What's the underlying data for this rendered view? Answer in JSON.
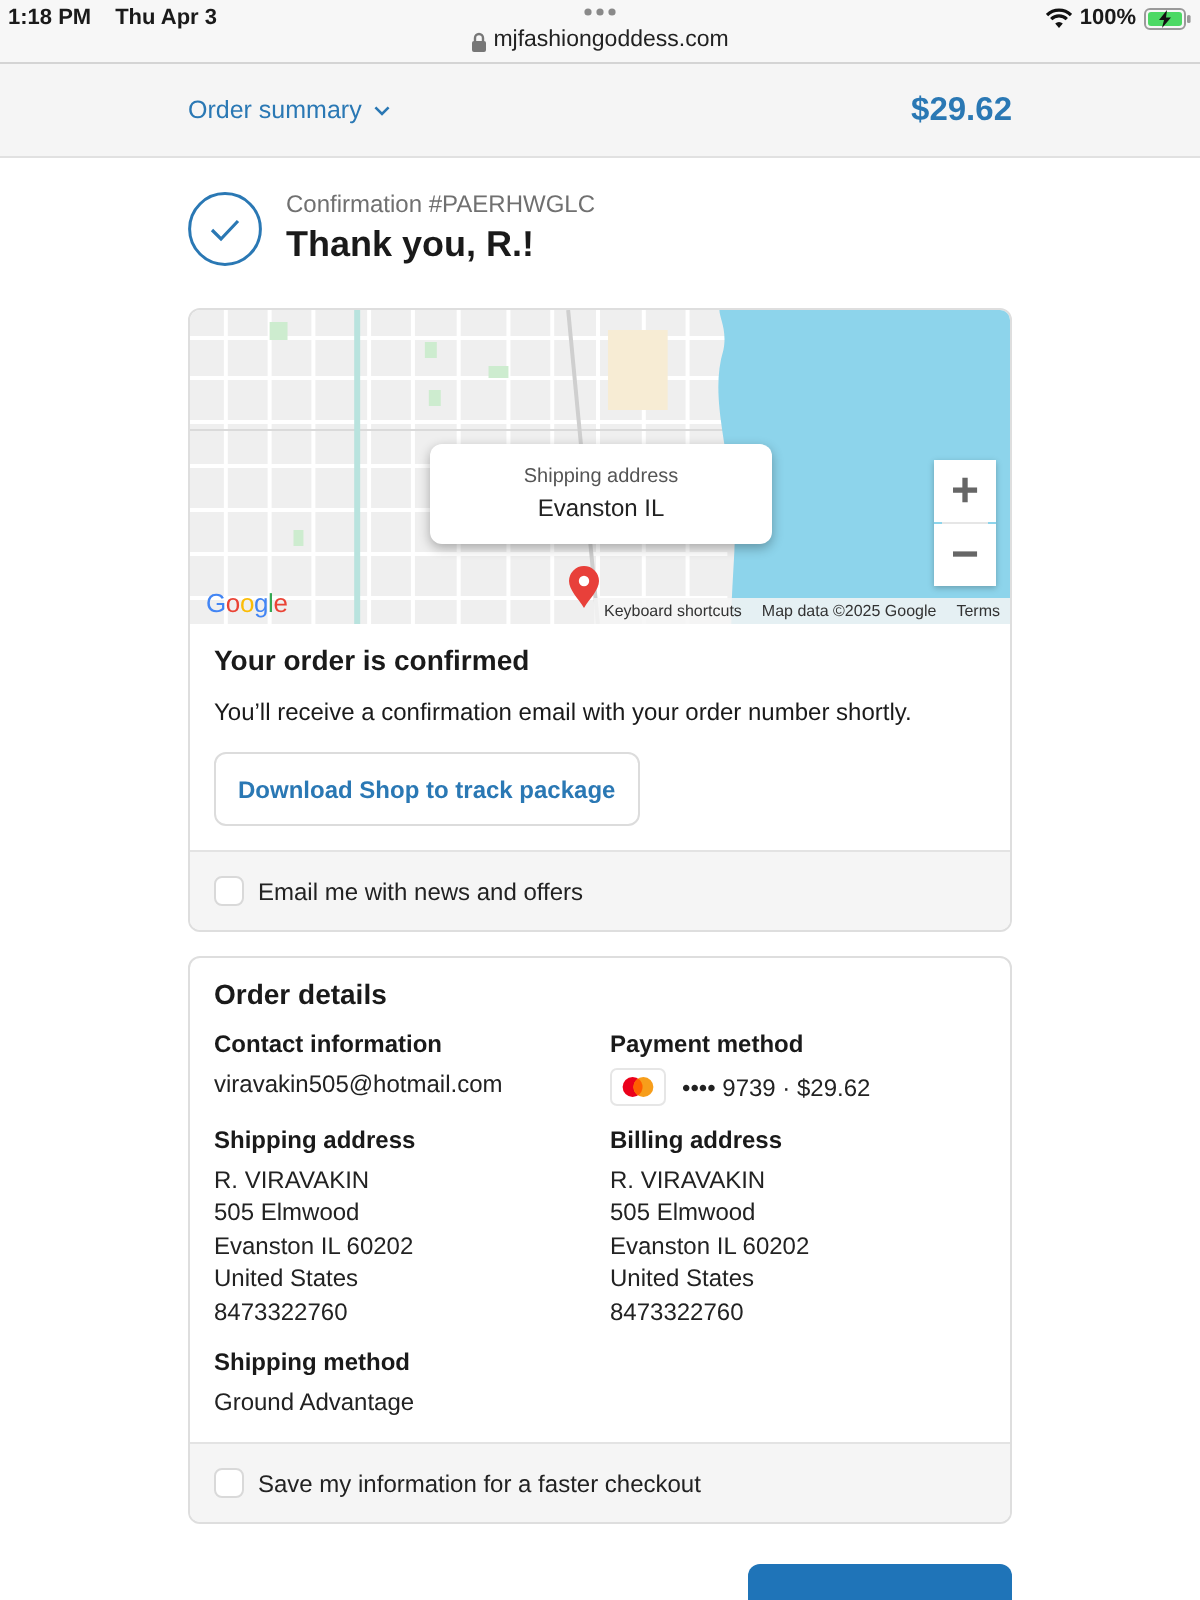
{
  "status_bar": {
    "time": "1:18 PM",
    "date": "Thu Apr 3",
    "battery": "100%"
  },
  "address_bar": {
    "url": "mjfashiongoddess.com"
  },
  "order_summary": {
    "label": "Order summary",
    "total": "$29.62"
  },
  "header": {
    "confirmation": "Confirmation #PAERHWGLC",
    "title": "Thank you, R.!"
  },
  "map": {
    "popup": {
      "label": "Shipping address",
      "value": "Evanston IL"
    },
    "zoom_in": "+",
    "zoom_out": "−",
    "logo": "Google",
    "attributions": [
      "Keyboard shortcuts",
      "Map data ©2025 Google",
      "Terms"
    ]
  },
  "confirmation": {
    "title": "Your order is confirmed",
    "message": "You’ll receive a confirmation email with your order number shortly.",
    "button": "Download Shop to track package",
    "checkbox": {
      "label": "Email me with news and offers",
      "checked": false
    }
  },
  "order_details": {
    "title": "Order details",
    "sections": [
      {
        "kind": "text",
        "heading": "Contact information",
        "lines": [
          "viravakin505@hotmail.com"
        ]
      },
      {
        "kind": "payment",
        "heading": "Payment method",
        "card": "•••• 9739 · $29.62"
      },
      {
        "kind": "text",
        "heading": "Shipping address",
        "lines": [
          "R. VIRAVAKIN",
          "505 Elmwood",
          "Evanston IL 60202",
          "United States",
          "8473322760"
        ]
      },
      {
        "kind": "text",
        "heading": "Billing address",
        "lines": [
          "R. VIRAVAKIN",
          "505 Elmwood",
          "Evanston IL 60202",
          "United States",
          "8473322760"
        ]
      },
      {
        "kind": "text",
        "heading": "Shipping method",
        "lines": [
          "Ground Advantage"
        ]
      }
    ],
    "checkbox": {
      "label": "Save my information for a faster checkout",
      "checked": false
    }
  },
  "footer": {
    "buttons": [
      {
        "kind": "primary"
      }
    ]
  }
}
